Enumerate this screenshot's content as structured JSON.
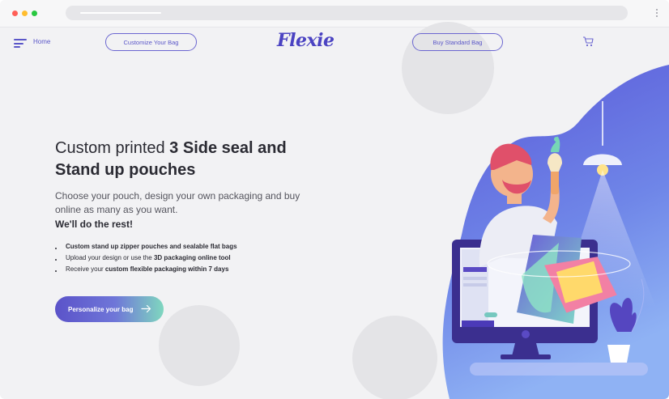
{
  "browser": {
    "traffic_lights": {
      "close": "#ff5f57",
      "minimize": "#ffbd2e",
      "maximize": "#28c840"
    }
  },
  "nav": {
    "menu_icon": "hamburger-icon",
    "home_label": "Home",
    "customize_label": "Customize Your Bag",
    "logo_text": "Flexie",
    "standard_label": "Buy Standard Bag",
    "cart_icon": "cart-icon"
  },
  "hero": {
    "title_light": "Custom printed ",
    "title_bold_1": "3 Side seal and",
    "title_bold_2": "Stand up pouches",
    "subtitle": "Choose your pouch, design your own packaging and buy online as many as you want.",
    "tagline": "We'll do the rest!",
    "bullets": [
      {
        "bold": "Custom stand up zipper pouches and sealable flat bags",
        "rest": ""
      },
      {
        "pre": "Upload your design or use the ",
        "bold": "3D packaging online tool"
      },
      {
        "pre": "Receive your ",
        "bold": "custom flexible packaging within 7 days"
      }
    ],
    "cta_label": "Personalize your bag",
    "cta_icon": "arrow-right-icon"
  },
  "colors": {
    "accent": "#5a56c8",
    "logo": "#4b43c2",
    "illustration_bg": "#6a6ee0"
  }
}
